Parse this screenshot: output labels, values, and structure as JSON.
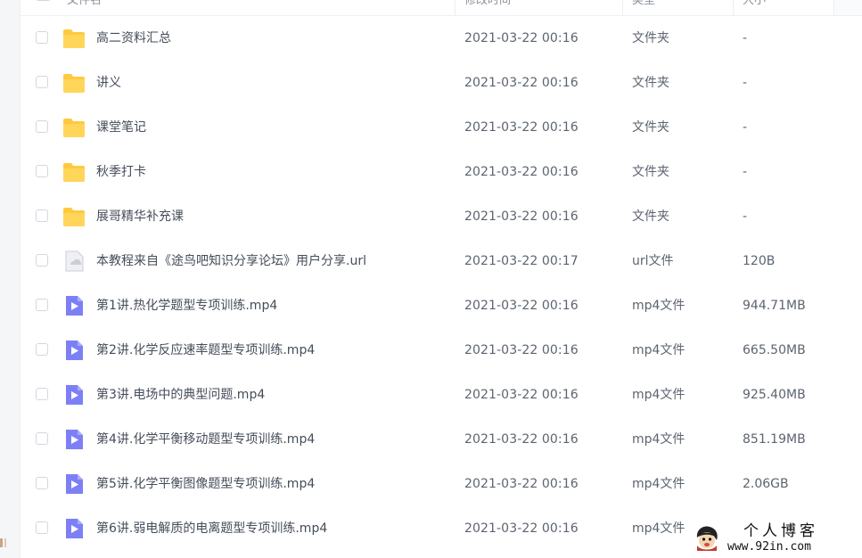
{
  "header": {
    "col_name": "文件名",
    "col_time": "修改时间",
    "col_type": "类型",
    "col_size": "大小"
  },
  "files": [
    {
      "name": "高二资料汇总",
      "time": "2021-03-22 00:16",
      "type": "文件夹",
      "size": "-",
      "icon": "folder-icon"
    },
    {
      "name": "讲义",
      "time": "2021-03-22 00:16",
      "type": "文件夹",
      "size": "-",
      "icon": "folder-icon"
    },
    {
      "name": "课堂笔记",
      "time": "2021-03-22 00:16",
      "type": "文件夹",
      "size": "-",
      "icon": "folder-icon"
    },
    {
      "name": "秋季打卡",
      "time": "2021-03-22 00:16",
      "type": "文件夹",
      "size": "-",
      "icon": "folder-icon"
    },
    {
      "name": "展哥精华补充课",
      "time": "2021-03-22 00:16",
      "type": "文件夹",
      "size": "-",
      "icon": "folder-icon"
    },
    {
      "name": "本教程来自《途鸟吧知识分享论坛》用户分享.url",
      "time": "2021-03-22 00:17",
      "type": "url文件",
      "size": "120B",
      "icon": "url-file-icon"
    },
    {
      "name": "第1讲.热化学题型专项训练.mp4",
      "time": "2021-03-22 00:16",
      "type": "mp4文件",
      "size": "944.71MB",
      "icon": "video-file-icon"
    },
    {
      "name": "第2讲.化学反应速率题型专项训练.mp4",
      "time": "2021-03-22 00:16",
      "type": "mp4文件",
      "size": "665.50MB",
      "icon": "video-file-icon"
    },
    {
      "name": "第3讲.电场中的典型问题.mp4",
      "time": "2021-03-22 00:16",
      "type": "mp4文件",
      "size": "925.40MB",
      "icon": "video-file-icon"
    },
    {
      "name": "第4讲.化学平衡移动题型专项训练.mp4",
      "time": "2021-03-22 00:16",
      "type": "mp4文件",
      "size": "851.19MB",
      "icon": "video-file-icon"
    },
    {
      "name": "第5讲.化学平衡图像题型专项训练.mp4",
      "time": "2021-03-22 00:16",
      "type": "mp4文件",
      "size": "2.06GB",
      "icon": "video-file-icon"
    },
    {
      "name": "第6讲.弱电解质的电离题型专项训练.mp4",
      "time": "2021-03-22 00:16",
      "type": "mp4文件",
      "size": "",
      "icon": "video-file-icon"
    }
  ],
  "watermark": {
    "title": "个人博客",
    "url": "www.92in.com"
  },
  "colors": {
    "folder": "#ffc93f",
    "video": "#7d80f5",
    "url_file": "#c9ced6",
    "sort_arrow": "#2c8ef5"
  }
}
